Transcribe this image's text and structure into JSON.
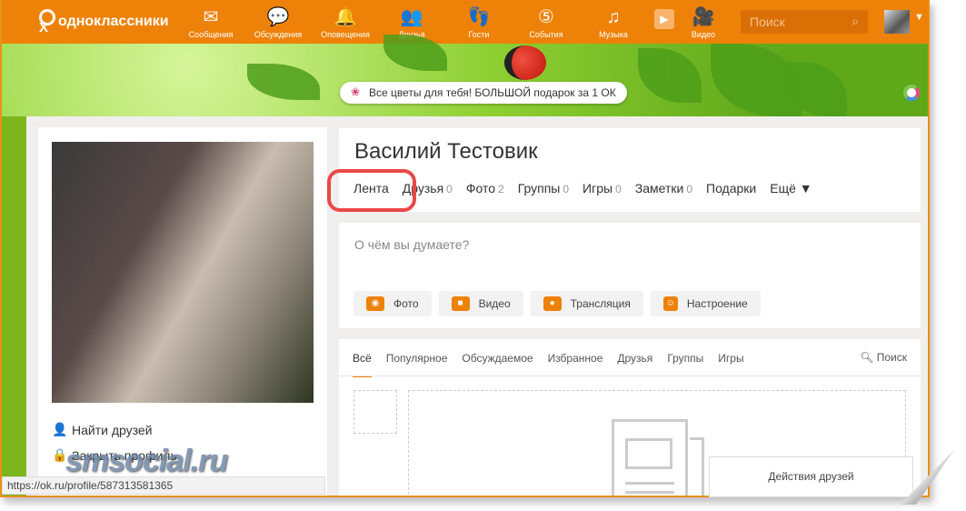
{
  "header": {
    "logo": "одноклассники",
    "nav": [
      {
        "label": "Сообщения",
        "icon": "envelope-icon"
      },
      {
        "label": "Обсуждения",
        "icon": "chat-icon"
      },
      {
        "label": "Оповещения",
        "icon": "bell-icon"
      },
      {
        "label": "Друзья",
        "icon": "friends-icon"
      },
      {
        "label": "Гости",
        "icon": "footprints-icon"
      },
      {
        "label": "События",
        "icon": "events-icon"
      },
      {
        "label": "Музыка",
        "icon": "music-icon"
      },
      {
        "label": "Видео",
        "icon": "video-icon"
      }
    ],
    "search_placeholder": "Поиск"
  },
  "banner": {
    "promo": "Все цветы для тебя! БОЛЬШОЙ подарок за 1 ОК"
  },
  "profile": {
    "name": "Василий Тестовик",
    "tabs": [
      {
        "label": "Лента",
        "count": null
      },
      {
        "label": "Друзья",
        "count": "0"
      },
      {
        "label": "Фото",
        "count": "2"
      },
      {
        "label": "Группы",
        "count": "0"
      },
      {
        "label": "Игры",
        "count": "0"
      },
      {
        "label": "Заметки",
        "count": "0"
      },
      {
        "label": "Подарки",
        "count": null
      },
      {
        "label": "Ещё ▼",
        "count": null
      }
    ]
  },
  "sidebar": {
    "links": [
      "Найти друзей",
      "Закрыть профиль"
    ]
  },
  "post": {
    "placeholder": "О чём вы думаете?",
    "buttons": [
      "Фото",
      "Видео",
      "Трансляция",
      "Настроение"
    ]
  },
  "feed": {
    "tabs": [
      "Всё",
      "Популярное",
      "Обсуждаемое",
      "Избранное",
      "Друзья",
      "Группы",
      "Игры"
    ],
    "search": "Поиск",
    "friends_actions": "Действия друзей"
  },
  "status_url": "https://ok.ru/profile/587313581365",
  "watermark": "smsocial.ru"
}
